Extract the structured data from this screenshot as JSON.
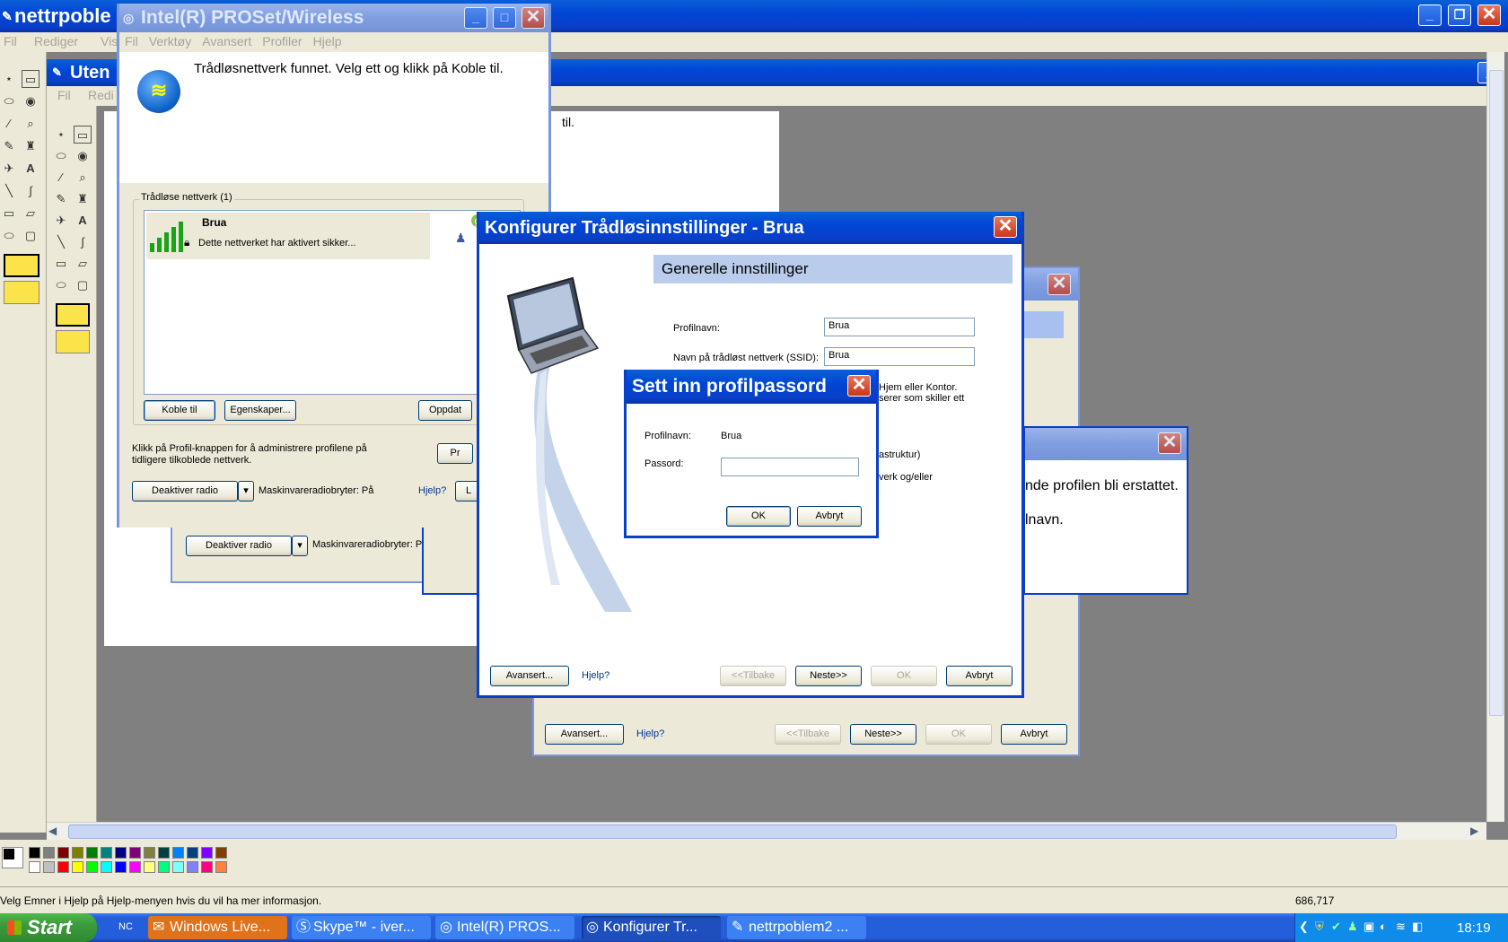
{
  "paint": {
    "title": "nettrpoble",
    "menu": [
      "Fil",
      "Rediger",
      "Vis"
    ],
    "status_text": "Velg Emner i Hjelp på Hjelp-menyen hvis du vil ha mer informasjon.",
    "coords": "686,717"
  },
  "paint2": {
    "title": "Uten",
    "menu": [
      "Fil",
      "Redi"
    ],
    "partial_text": "til."
  },
  "proset": {
    "title": "Intel(R) PROSet/Wireless",
    "menu": [
      "Fil",
      "Verktøy",
      "Avansert",
      "Profiler",
      "Hjelp"
    ],
    "heading": "Trådløsnettverk funnet. Velg ett og klikk på Koble til.",
    "group_label": "Trådløse nettverk (1)",
    "network_name": "Brua",
    "network_desc": "Dette nettverket har aktivert sikker...",
    "connect_btn": "Koble til",
    "properties_btn": "Egenskaper...",
    "refresh_btn": "Oppdat",
    "profile_text": "Klikk på Profil-knappen for å administrere profilene på tidligere tilkoblede nettverk.",
    "profile_btn": "Pr",
    "radio_btn": "Deaktiver radio",
    "hw_switch": "Maskinvareradiobryter: På",
    "help_link": "Hjelp?",
    "close_btn": "L"
  },
  "behind": {
    "radio_btn": "Deaktiver radio",
    "hw_switch": "Maskinvareradiobryter: På"
  },
  "config": {
    "title": "Konfigurer Trådløsinnstillinger - Brua",
    "section": "Generelle innstillinger",
    "profile_label": "Profilnavn:",
    "profile_value": "Brua",
    "ssid_label": "Navn på trådløst nettverk (SSID):",
    "partial1": "Hjem eller Kontor.",
    "partial2": "serer som skiller ett",
    "partial3": "astruktur)",
    "partial4": "verk og/eller",
    "advanced_btn": "Avansert...",
    "help_link": "Hjelp?",
    "back_btn": "<<Tilbake",
    "next_btn": "Neste>>",
    "ok_btn": "OK",
    "cancel_btn": "Avbryt"
  },
  "config2": {
    "advanced_btn": "Avansert...",
    "help_link": "Hjelp?",
    "back_btn": "<<Tilbake",
    "next_btn": "Neste>>",
    "ok_btn": "OK",
    "cancel_btn": "Avbryt"
  },
  "msg": {
    "line1": "nde profilen bli erstattet.",
    "line2": "lnavn."
  },
  "pwd": {
    "title": "Sett inn profilpassord",
    "profile_label": "Profilnavn:",
    "profile_value": "Brua",
    "password_label": "Passord:",
    "password_value": "",
    "ok_btn": "OK",
    "cancel_btn": "Avbryt"
  },
  "taskbar": {
    "start": "Start",
    "tray_nc": "NC",
    "tasks": [
      "Windows Live...",
      "Skype™ - iver...",
      "Intel(R) PROS...",
      "Konfigurer Tr...",
      "nettrpoblem2 ..."
    ],
    "clock": "18:19"
  },
  "colors": {
    "titlebar": "#0a3fc8",
    "taskbar": "#245edb",
    "start": "#3c9a3c",
    "dialog_face": "#ece9d8"
  }
}
